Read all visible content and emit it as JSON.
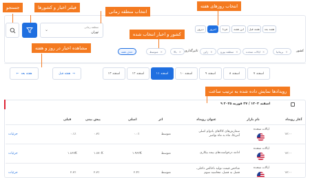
{
  "callouts": {
    "days_of_week": "انتخاب روزهای هفته",
    "timezone": "انتخاب منطقه زمانی",
    "search": "جستجو",
    "filter": "فیلتر اخبار و کشورها",
    "selected": "کشور و اخبار انتخاب شده",
    "view_news": "مشاهده اخبار در روز و هفته",
    "events_sorted": "رویدادها نمایش داده شده به ترتیب ساعت"
  },
  "period_tabs": [
    "دیروز",
    "امروز",
    "فردا",
    "این هفته",
    "هفته قبل",
    "هفته بعد"
  ],
  "active_period_index": 1,
  "timezone": {
    "label": "منطقه زمانی",
    "value": "تهران"
  },
  "filters": {
    "country_label": "کشور",
    "country_chips": [
      "بریتانیا",
      "ایالات متحده",
      "منطقه یورو",
      "ژاپن"
    ],
    "importance_label": "تاثیرگذاری",
    "importance_chips": [
      "بالا",
      "متوسط"
    ],
    "clear_label": "حذف همه"
  },
  "week_nav": {
    "prev_week": "هفته قبل",
    "next_week": "هفته بعد",
    "days": [
      "۷ اسفند",
      "۸ اسفند",
      "۹ اسفند",
      "۱۰ اسفند",
      "۱۱ اسفند",
      "۱۲ اسفند",
      "۱۳ اسفند"
    ],
    "active_day_index": 3
  },
  "date_header": "۹ اسفند ۱۴۰۳ / ۲۷ فوریه ۲۰۲۵",
  "table": {
    "headers": {
      "time": "آغاز رویداد",
      "market": "نام بازار",
      "title": "عنوان رویداد",
      "impact": "اثر",
      "actual": "اصلی",
      "forecast": "پیش بینی",
      "previous": "قبلی"
    },
    "rows": [
      {
        "time": "۱۷:۰۰",
        "market": "ایالات متحده",
        "title": "سفارش‌های کالاهای بادوام اصلی آمریکا، ماه به ماه نوامبر",
        "impact": "متوسط",
        "actual": "۰.۰٪",
        "forecast": "۰.۳٪",
        "previous": "۰.۱٪",
        "detail": "جزئیات"
      },
      {
        "time": "۱۷:۰۰",
        "market": "ایالات متحده",
        "title": "ادامه درخواست‌های بیمه بیکاری",
        "impact": "متوسط",
        "actual": "۱.۹۶۲K",
        "forecast": "۱.۸۷۰K",
        "previous": "۱.۸۶۷K",
        "detail": "جزئیات"
      },
      {
        "time": "۱۷:۰۰",
        "market": "ایالات متحده",
        "title": "شاخص قیمت تولید ناخالص داخلی، فصل به فصل، محاسبه سوم",
        "impact": "متوسط",
        "actual": "۲.۴٪",
        "forecast": "۲.۳٪",
        "previous": "۲.۳٪",
        "detail": "جزئیات"
      }
    ]
  },
  "colors": {
    "accent": "#1f6fe0",
    "callout": "#f47a20"
  }
}
